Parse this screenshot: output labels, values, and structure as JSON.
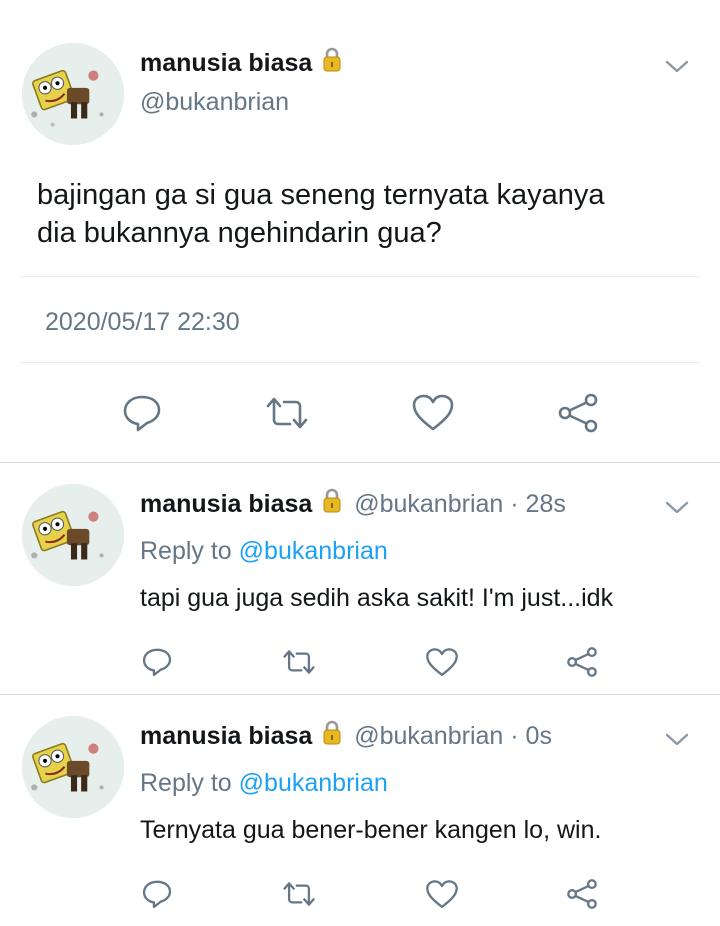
{
  "main_tweet": {
    "display_name": "manusia biasa",
    "handle": "@bukanbrian",
    "text_line1": "bajingan ga si gua seneng ternyata kayanya",
    "text_line2": "dia bukannya ngehindarin gua?",
    "timestamp": "2020/05/17 22:30"
  },
  "replies": [
    {
      "display_name": "manusia biasa",
      "handle": "@bukanbrian",
      "time": "28s",
      "reply_prefix": "Reply to",
      "reply_to": "@bukanbrian",
      "text": "tapi gua juga sedih aska sakit! I'm just...idk"
    },
    {
      "display_name": "manusia biasa",
      "handle": "@bukanbrian",
      "time": "0s",
      "reply_prefix": "Reply to",
      "reply_to": "@bukanbrian",
      "text": "Ternyata gua bener-bener kangen lo, win."
    }
  ],
  "separator": "·",
  "icons": {
    "protected": "lock-icon",
    "menu": "chevron-down-icon",
    "reply": "reply-icon",
    "retweet": "retweet-icon",
    "like": "heart-icon",
    "share": "share-icon"
  },
  "colors": {
    "text": "#14171a",
    "muted": "#657786",
    "link": "#1da1f2",
    "icon": "#657786",
    "lock": "#e8b923",
    "divider": "#e6ecf0"
  }
}
